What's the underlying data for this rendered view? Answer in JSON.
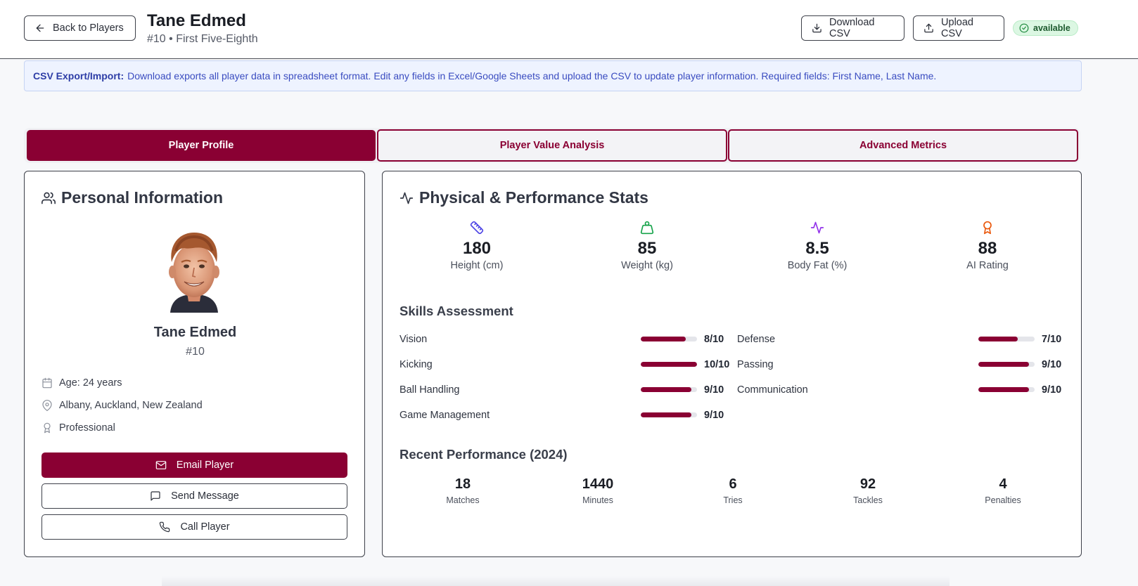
{
  "header": {
    "back_label": "Back to Players",
    "player_name": "Tane Edmed",
    "subtitle": "#10 • First Five-Eighth",
    "download_label": "Download CSV",
    "upload_label": "Upload CSV",
    "status": "available"
  },
  "banner": {
    "title": "CSV Export/Import:",
    "text": "Download exports all player data in spreadsheet format. Edit any fields in Excel/Google Sheets and upload the CSV to update player information. Required fields: First Name, Last Name."
  },
  "tabs": [
    {
      "label": "Player Profile",
      "active": true
    },
    {
      "label": "Player Value Analysis",
      "active": false
    },
    {
      "label": "Advanced Metrics",
      "active": false
    }
  ],
  "personal": {
    "heading": "Personal Information",
    "name": "Tane Edmed",
    "number": "#10",
    "age": "Age: 24 years",
    "location": "Albany, Auckland, New Zealand",
    "level": "Professional",
    "email_label": "Email Player",
    "message_label": "Send Message",
    "call_label": "Call Player"
  },
  "stats": {
    "heading": "Physical & Performance Stats",
    "items": [
      {
        "value": "180",
        "label": "Height (cm)",
        "icon": "ruler-icon",
        "color": "#4f46e5"
      },
      {
        "value": "85",
        "label": "Weight (kg)",
        "icon": "weight-icon",
        "color": "#16a34a"
      },
      {
        "value": "8.5",
        "label": "Body Fat (%)",
        "icon": "activity-icon",
        "color": "#9333ea"
      },
      {
        "value": "88",
        "label": "AI Rating",
        "icon": "award-icon",
        "color": "#ea580c"
      }
    ]
  },
  "skills": {
    "heading": "Skills Assessment",
    "left": [
      {
        "name": "Vision",
        "score": "8/10",
        "value": 8
      },
      {
        "name": "Kicking",
        "score": "10/10",
        "value": 10
      },
      {
        "name": "Ball Handling",
        "score": "9/10",
        "value": 9
      },
      {
        "name": "Game Management",
        "score": "9/10",
        "value": 9
      }
    ],
    "right": [
      {
        "name": "Defense",
        "score": "7/10",
        "value": 7
      },
      {
        "name": "Passing",
        "score": "9/10",
        "value": 9
      },
      {
        "name": "Communication",
        "score": "9/10",
        "value": 9
      }
    ]
  },
  "performance": {
    "heading": "Recent Performance (2024)",
    "items": [
      {
        "value": "18",
        "label": "Matches"
      },
      {
        "value": "1440",
        "label": "Minutes"
      },
      {
        "value": "6",
        "label": "Tries"
      },
      {
        "value": "92",
        "label": "Tackles"
      },
      {
        "value": "4",
        "label": "Penalties"
      }
    ]
  },
  "colors": {
    "brand": "#8a0033",
    "badge_bg": "#dcf7e3"
  }
}
